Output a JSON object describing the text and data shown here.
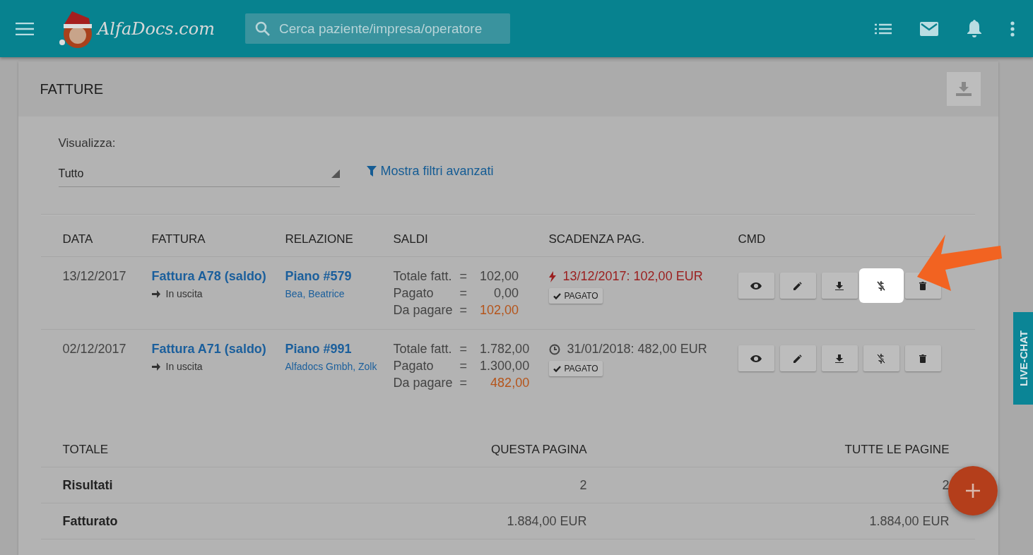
{
  "topbar": {
    "logo": "AlfaDocs.com",
    "search": {
      "placeholder": "Cerca paziente/impresa/operatore"
    }
  },
  "page": {
    "title": "FATTURE"
  },
  "filter": {
    "label": "Visualizza:",
    "value": "Tutto",
    "advanced_link": "Mostra filtri avanzati"
  },
  "table": {
    "columns": [
      "DATA",
      "FATTURA",
      "RELAZIONE",
      "SALDI",
      "SCADENZA PAG.",
      "CMD"
    ],
    "rows": [
      {
        "date": "13/12/2017",
        "invoice": "Fattura A78 (saldo)",
        "direction": "In uscita",
        "relation": "Piano #579",
        "person": "Bea, Beatrice",
        "balances": [
          {
            "label": "Totale fatt.",
            "eq": "=",
            "value": "102,00",
            "due": false
          },
          {
            "label": "Pagato",
            "eq": "=",
            "value": "0,00",
            "due": false
          },
          {
            "label": "Da pagare",
            "eq": "=",
            "value": "102,00",
            "due": true
          }
        ],
        "deadline": {
          "kind": "overdue",
          "text": "13/12/2017: 102,00 EUR"
        },
        "status": "PAGATO",
        "commands": [
          {
            "kind": "view",
            "highlighted": false
          },
          {
            "kind": "edit",
            "highlighted": false
          },
          {
            "kind": "download",
            "highlighted": false
          },
          {
            "kind": "unpay",
            "highlighted": true
          },
          {
            "kind": "delete",
            "highlighted": false
          }
        ]
      },
      {
        "date": "02/12/2017",
        "invoice": "Fattura A71 (saldo)",
        "direction": "In uscita",
        "relation": "Piano #991",
        "person": "Alfadocs Gmbh, Zolk",
        "balances": [
          {
            "label": "Totale fatt.",
            "eq": "=",
            "value": "1.782,00",
            "due": false
          },
          {
            "label": "Pagato",
            "eq": "=",
            "value": "1.300,00",
            "due": false
          },
          {
            "label": "Da pagare",
            "eq": "=",
            "value": "482,00",
            "due": true
          }
        ],
        "deadline": {
          "kind": "pending",
          "text": "31/01/2018: 482,00 EUR"
        },
        "status": "PAGATO",
        "commands": [
          {
            "kind": "view",
            "highlighted": false
          },
          {
            "kind": "edit",
            "highlighted": false
          },
          {
            "kind": "download",
            "highlighted": false
          },
          {
            "kind": "unpay",
            "highlighted": false
          },
          {
            "kind": "delete",
            "highlighted": false
          }
        ]
      }
    ]
  },
  "totals": {
    "columns": [
      "TOTALE",
      "QUESTA PAGINA",
      "TUTTE LE PAGINE"
    ],
    "rows": [
      {
        "label": "Risultati",
        "page": "2",
        "all": "2"
      },
      {
        "label": "Fatturato",
        "page": "1.884,00 EUR",
        "all": "1.884,00 EUR"
      }
    ]
  },
  "live_chat": "LIVE-CHAT"
}
